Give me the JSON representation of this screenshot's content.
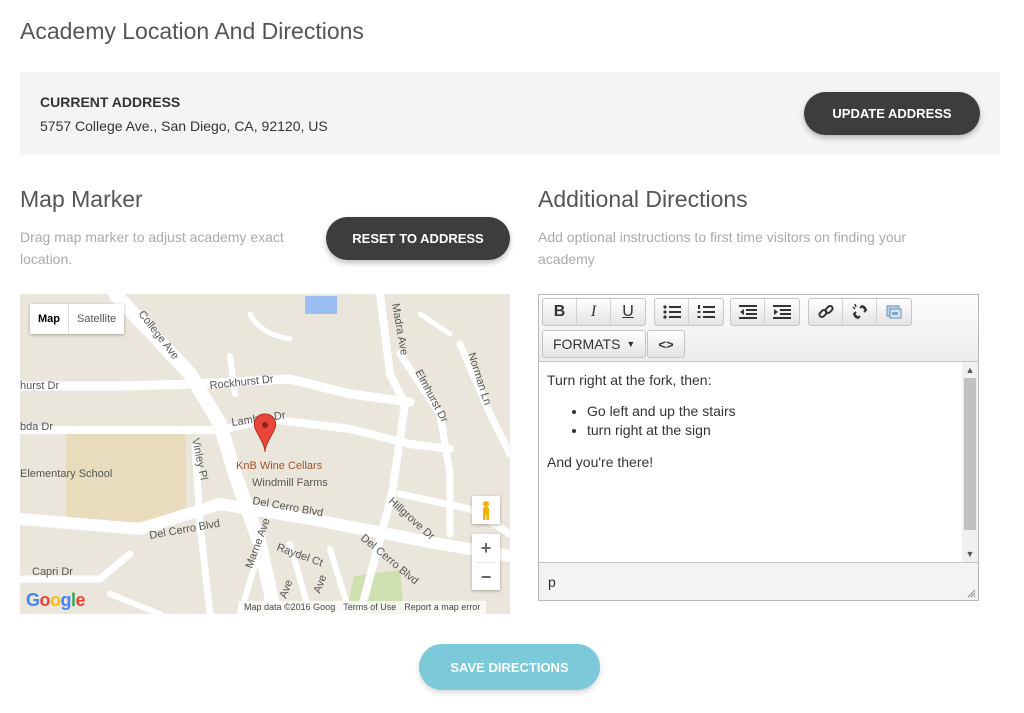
{
  "page": {
    "title": "Academy Location And Directions"
  },
  "address": {
    "heading": "CURRENT ADDRESS",
    "value": "5757 College Ave., San Diego, CA, 92120, US",
    "update_label": "UPDATE ADDRESS"
  },
  "marker": {
    "title": "Map Marker",
    "description": "Drag map marker to adjust academy exact location.",
    "reset_label": "RESET TO ADDRESS"
  },
  "map": {
    "type_active": "Map",
    "type_inactive": "Satellite",
    "streets": [
      "College Ave",
      "Rockhurst Dr",
      "Lambda Dr",
      "Vinley Pl",
      "Del Cerro Blvd",
      "Madra Ave",
      "Elmhurst Dr",
      "Norman Ln",
      "Hillgrove Dr",
      "Marne Ave",
      "Raydel Ct",
      "Capri Dr",
      "Del Cerro Blvd",
      "Ave",
      "Ave",
      "hurst Dr",
      "bda Dr",
      "Del Cerro Blvd"
    ],
    "places": [
      "Elementary School",
      "KnB Wine Cellars",
      "Windmill Farms"
    ],
    "logo": "Google",
    "footer": [
      "Map data ©2016 Goog",
      "Terms of Use",
      "Report a map error"
    ],
    "zoom_in": "+",
    "zoom_out": "−"
  },
  "directions": {
    "title": "Additional Directions",
    "description": "Add optional instructions to first time visitors on finding your academy",
    "toolbar": {
      "bold": "B",
      "italic": "I",
      "underline": "U",
      "formats": "FORMATS",
      "code": "<>"
    },
    "content": {
      "intro": "Turn right at the fork, then:",
      "items": [
        "Go left and up the stairs",
        "turn right at the sign"
      ],
      "outro": "And you're there!"
    },
    "status_path": "p"
  },
  "save": {
    "label": "SAVE DIRECTIONS"
  },
  "colors": {
    "dark_button": "#3d3d3d",
    "save_button": "#7bc9d9",
    "panel": "#f4f4f4",
    "marker": "#e8463c"
  }
}
